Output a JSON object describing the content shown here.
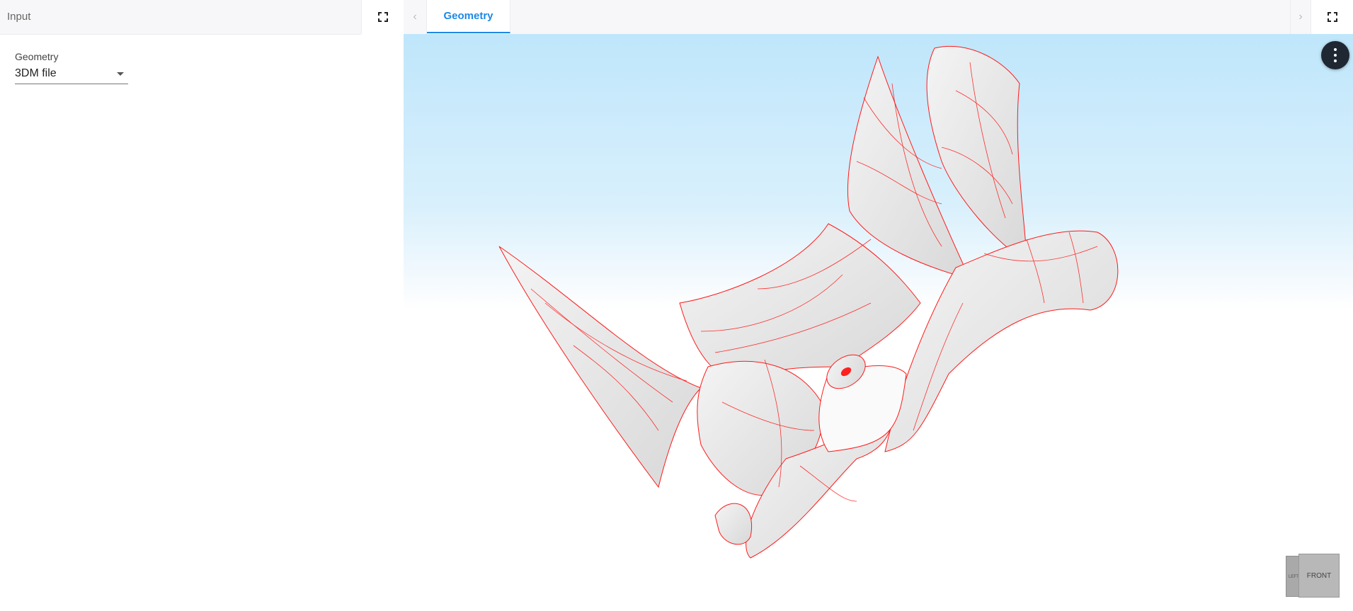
{
  "left_panel": {
    "title": "Input",
    "field": {
      "label": "Geometry",
      "value": "3DM file"
    }
  },
  "right_panel": {
    "tabs": [
      {
        "label": "Geometry",
        "active": true
      }
    ],
    "prev_symbol": "‹",
    "next_symbol": "›"
  },
  "viewer": {
    "sky_color": "#bfe6fb",
    "ground_color": "#ffffff",
    "surface_color": "#e6e6e6",
    "isocurve_color": "#ff1a1a",
    "nav_cube": {
      "front_label": "FRONT",
      "side_label": "LEFT"
    }
  },
  "icons": {
    "expand": "fullscreen-icon",
    "menu": "more-vertical-icon"
  }
}
